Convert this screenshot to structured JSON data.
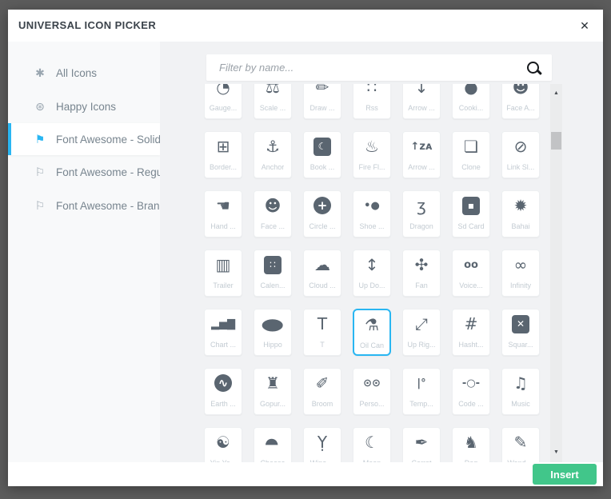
{
  "window": {
    "title": "UNIVERSAL ICON PICKER",
    "close_glyph": "✕"
  },
  "colors": {
    "accent_blue": "#29b6f2",
    "insert_green": "#41c68a",
    "icon_slate": "#5a6570"
  },
  "sidebar": {
    "items": [
      {
        "id": "all-icons",
        "label": "All Icons",
        "icon": "asterisk-icon",
        "glyph": "✱",
        "active": false
      },
      {
        "id": "happy-icons",
        "label": "Happy Icons",
        "icon": "award-icon",
        "glyph": "⊛",
        "active": false
      },
      {
        "id": "fa-solid",
        "label": "Font Awesome - Solid",
        "icon": "flag-icon",
        "glyph": "⚑",
        "active": true
      },
      {
        "id": "fa-regular",
        "label": "Font Awesome - Regular",
        "icon": "flag-icon",
        "glyph": "⚐",
        "active": false
      },
      {
        "id": "fa-brands",
        "label": "Font Awesome - Brands",
        "icon": "flag-icon",
        "glyph": "⚐",
        "active": false
      }
    ]
  },
  "search": {
    "placeholder": "Filter by name..."
  },
  "scrollbar": {
    "up_glyph": "▲",
    "down_glyph": "▼"
  },
  "footer": {
    "insert_label": "Insert"
  },
  "grid": {
    "rows": [
      [
        {
          "name": "gauge",
          "label": "Gauge...",
          "glyph": "◔"
        },
        {
          "name": "scale",
          "label": "Scale ...",
          "glyph": "⚖"
        },
        {
          "name": "draw",
          "label": "Draw ...",
          "glyph": "✏"
        },
        {
          "name": "rss",
          "label": "Rss",
          "glyph": "∷"
        },
        {
          "name": "arrow-down",
          "label": "Arrow ...",
          "glyph": "↓"
        },
        {
          "name": "cookie",
          "label": "Cooki...",
          "glyph": "●"
        },
        {
          "name": "face-a",
          "label": "Face A...",
          "glyph": "☻"
        }
      ],
      [
        {
          "name": "border-all",
          "label": "Border...",
          "glyph": "⊞"
        },
        {
          "name": "anchor",
          "label": "Anchor",
          "glyph": "⚓"
        },
        {
          "name": "book-quran",
          "label": "Book ...",
          "glyph": "☾",
          "style": "badge"
        },
        {
          "name": "fire-flame",
          "label": "Fire Fl...",
          "glyph": "♨"
        },
        {
          "name": "arrow-up-z-a",
          "label": "Arrow ...",
          "glyph": "↑ᴢᴀ",
          "mod": "small"
        },
        {
          "name": "clone",
          "label": "Clone",
          "glyph": "❏"
        },
        {
          "name": "link-slash",
          "label": "Link Sl...",
          "glyph": "⊘"
        }
      ],
      [
        {
          "name": "hand",
          "label": "Hand ...",
          "glyph": "☚"
        },
        {
          "name": "face-grin",
          "label": "Face ...",
          "glyph": "☻"
        },
        {
          "name": "circle-plus",
          "label": "Circle ...",
          "glyph": "+",
          "style": "circle"
        },
        {
          "name": "shoe-prints",
          "label": "Shoe ...",
          "glyph": "•●",
          "mod": "small"
        },
        {
          "name": "dragon",
          "label": "Dragon",
          "glyph": "ʒ"
        },
        {
          "name": "sd-card",
          "label": "Sd Card",
          "glyph": "▪",
          "style": "badge"
        },
        {
          "name": "bahai",
          "label": "Bahai",
          "glyph": "✹"
        }
      ],
      [
        {
          "name": "trailer",
          "label": "Trailer",
          "glyph": "▥"
        },
        {
          "name": "calendar",
          "label": "Calen...",
          "glyph": "∷",
          "style": "badge"
        },
        {
          "name": "cloud-moon",
          "label": "Cloud ...",
          "glyph": "☁"
        },
        {
          "name": "up-down",
          "label": "Up Do...",
          "glyph": "↕"
        },
        {
          "name": "fan",
          "label": "Fan",
          "glyph": "✣"
        },
        {
          "name": "voicemail",
          "label": "Voice...",
          "glyph": "oo",
          "mod": "small"
        },
        {
          "name": "infinity",
          "label": "Infinity",
          "glyph": "∞"
        }
      ],
      [
        {
          "name": "chart-column",
          "label": "Chart ...",
          "glyph": "▂▅▇",
          "mod": "small"
        },
        {
          "name": "hippo",
          "label": "Hippo",
          "glyph": "●",
          "mod": "wide"
        },
        {
          "name": "t",
          "label": "T",
          "glyph": "T"
        },
        {
          "name": "oil-can",
          "label": "Oil Can",
          "glyph": "⚗",
          "selected": true
        },
        {
          "name": "up-right",
          "label": "Up Rig...",
          "glyph": "⤢"
        },
        {
          "name": "hashtag",
          "label": "Hasht...",
          "glyph": "#"
        },
        {
          "name": "square-xmark",
          "label": "Squar...",
          "glyph": "✕",
          "style": "badge"
        }
      ],
      [
        {
          "name": "earth-europe",
          "label": "Earth ...",
          "glyph": "∿",
          "style": "circle"
        },
        {
          "name": "gopuram",
          "label": "Gopur...",
          "glyph": "♜"
        },
        {
          "name": "broom",
          "label": "Broom",
          "glyph": "✐"
        },
        {
          "name": "person-biking",
          "label": "Perso...",
          "glyph": "⊙⊙",
          "mod": "small"
        },
        {
          "name": "temperature",
          "label": "Temp...",
          "glyph": "|°",
          "mod": "small"
        },
        {
          "name": "code-commit",
          "label": "Code ...",
          "glyph": "-○-",
          "mod": "small"
        },
        {
          "name": "music",
          "label": "Music",
          "glyph": "♫"
        }
      ],
      [
        {
          "name": "yin-yang",
          "label": "Yin Ya...",
          "glyph": "☯"
        },
        {
          "name": "cheese",
          "label": "Cheese",
          "glyph": "◖",
          "mod": "rot90"
        },
        {
          "name": "wine-glass",
          "label": "Wine ...",
          "glyph": "Ỵ"
        },
        {
          "name": "moon",
          "label": "Moon",
          "glyph": "☾"
        },
        {
          "name": "carrot",
          "label": "Carrot",
          "glyph": "✒"
        },
        {
          "name": "dog",
          "label": "Dog",
          "glyph": "♞"
        },
        {
          "name": "wand",
          "label": "Wand ...",
          "glyph": "✎"
        }
      ]
    ]
  }
}
